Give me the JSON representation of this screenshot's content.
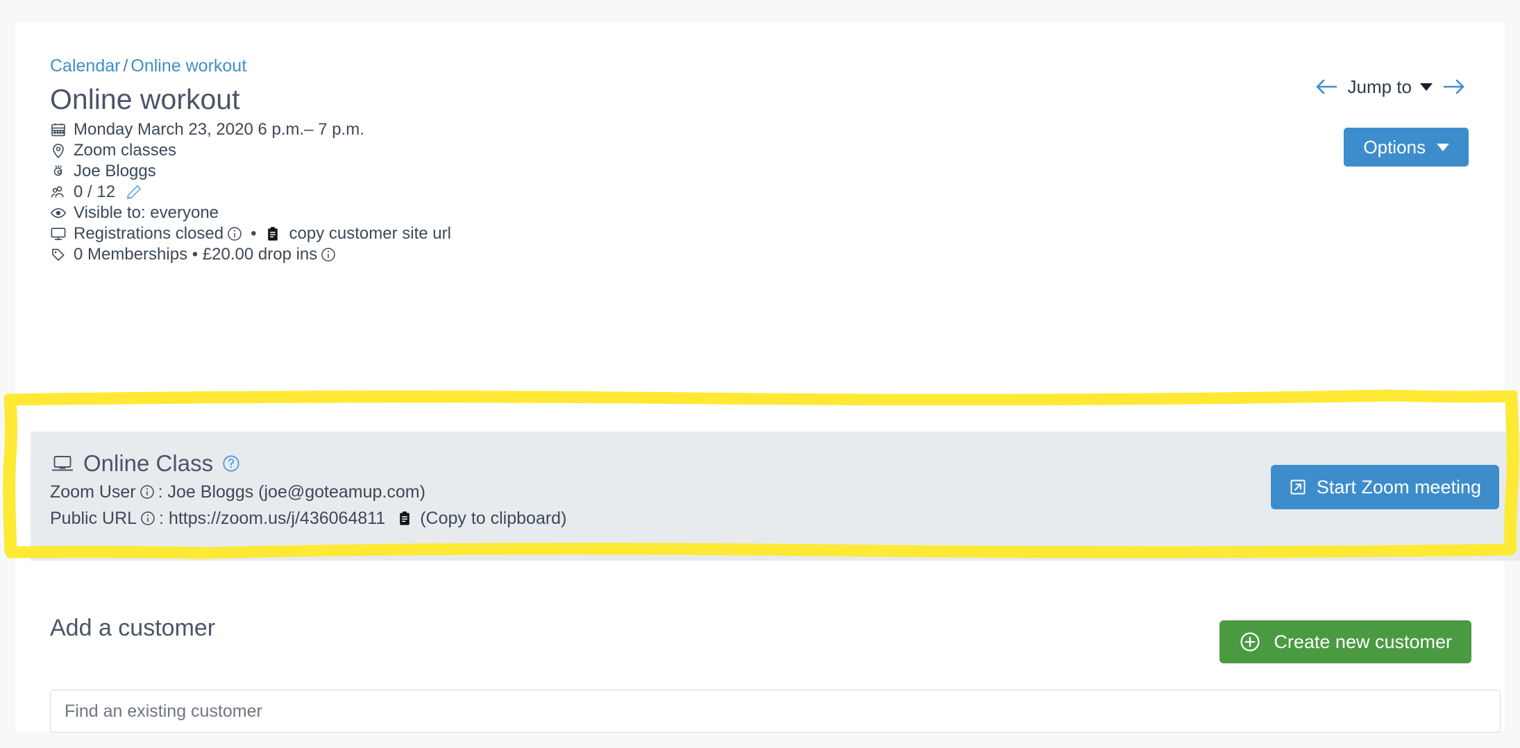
{
  "breadcrumb": {
    "root": "Calendar",
    "separator": "/",
    "current": "Online workout"
  },
  "page_title": "Online workout",
  "nav": {
    "prev_icon": "arrow-left-icon",
    "next_icon": "arrow-right-icon",
    "jump_to_label": "Jump to",
    "options_label": "Options"
  },
  "details": [
    {
      "icon": "calendar-icon",
      "text": "Monday March 23, 2020 6 p.m.– 7 p.m."
    },
    {
      "icon": "map-pin-icon",
      "text": "Zoom classes"
    },
    {
      "icon": "teacher-hand-icon",
      "text": "Joe Bloggs"
    },
    {
      "icon": "users-icon",
      "text": "0 / 12",
      "edit_icon": "pencil-icon"
    },
    {
      "icon": "eye-icon",
      "text": "Visible to: everyone"
    },
    {
      "icon": "monitor-icon",
      "text": "Registrations closed",
      "info_icon": "info-circle-icon",
      "bullet": "•",
      "copy_icon": "clipboard-icon",
      "link_text": "copy customer site url"
    },
    {
      "icon": "tag-icon",
      "text": "0 Memberships • £20.00 drop ins",
      "info_icon": "info-circle-icon"
    }
  ],
  "online_class": {
    "icon": "laptop-icon",
    "title": "Online Class",
    "help_icon": "help-circle-icon",
    "zoom_user_label": "Zoom User",
    "zoom_user_info_icon": "info-circle-icon",
    "zoom_user_value": ": Joe Bloggs (joe@goteamup.com)",
    "public_url_label": "Public URL",
    "public_url_info_icon": "info-circle-icon",
    "public_url_value": ": https://zoom.us/j/436064811",
    "copy_icon": "clipboard-icon",
    "copy_label": "(Copy to clipboard)",
    "start_button_label": "Start Zoom meeting",
    "start_button_icon": "external-link-icon",
    "panel_bg": "#e8ebee",
    "highlight_color": "#ffe92e"
  },
  "add_customer": {
    "title": "Add a customer",
    "create_button_label": "Create new customer",
    "create_button_icon": "plus-circle-icon",
    "search_placeholder": "Find an existing customer"
  },
  "colors": {
    "link": "#3d8ecc",
    "primary_button": "#3d8dcc",
    "success_button": "#4a9a42",
    "text": "#3c4858",
    "page_bg": "#f7f8fa",
    "card_bg": "#ffffff"
  }
}
